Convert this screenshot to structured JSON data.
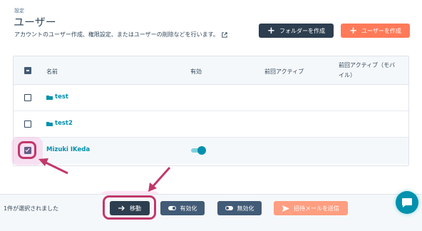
{
  "breadcrumb": "設定",
  "page_title": "ユーザー",
  "subtitle": "アカウントのユーザー作成、権限設定、またはユーザーの削除などを行います。",
  "header_buttons": {
    "create_folder": "フォルダーを作成",
    "create_user": "ユーザーを作成"
  },
  "table": {
    "columns": [
      "名前",
      "有効",
      "前回アクティブ",
      "前回アクティブ（モバイル）"
    ],
    "rows": [
      {
        "name": "test",
        "type": "folder",
        "selected": false
      },
      {
        "name": "test2",
        "type": "folder",
        "selected": false
      },
      {
        "name": "Mizuki IKeda",
        "type": "user",
        "selected": true,
        "enabled": true
      }
    ]
  },
  "footer": {
    "selected_count": "1件が選択されました",
    "move": "移動",
    "enable": "有効化",
    "disable": "無効化",
    "send_invite": "招待メールを送信"
  },
  "colors": {
    "accent": "#0091ae",
    "primary_dark": "#2d3e50",
    "orange": "#ff7a59",
    "highlight": "#c2386b"
  }
}
